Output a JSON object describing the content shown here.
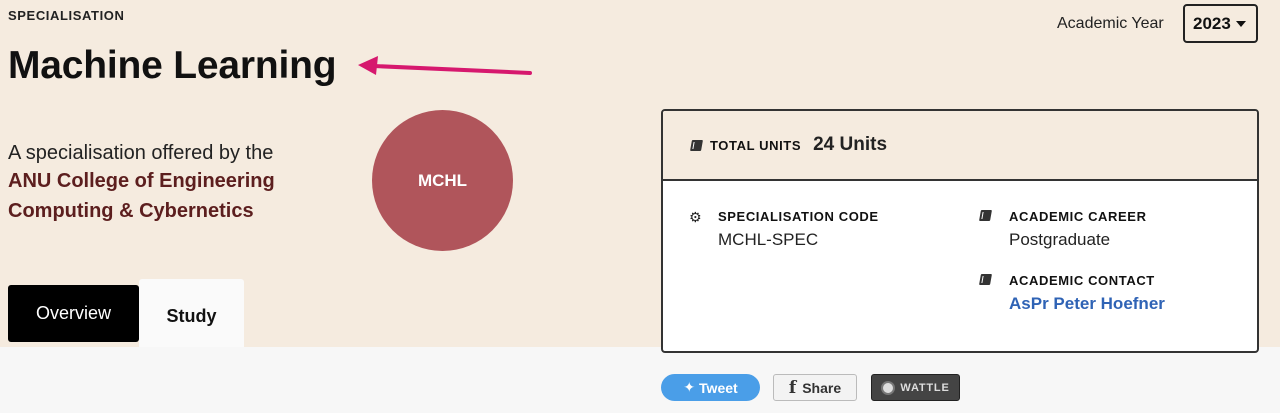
{
  "header": {
    "overline": "SPECIALISATION",
    "title": "Machine Learning",
    "academic_year_label": "Academic Year",
    "academic_year_value": "2023"
  },
  "intro": {
    "offered_by": "A specialisation offered by the",
    "college": "ANU College of Engineering Computing & Cybernetics",
    "badge": "MCHL"
  },
  "tabs": [
    {
      "label": "Overview",
      "active": true
    },
    {
      "label": "Study",
      "active": false
    }
  ],
  "card": {
    "total_units_label": "TOTAL UNITS",
    "total_units_value": "24 Units",
    "spec_code_label": "SPECIALISATION CODE",
    "spec_code_value": "MCHL-SPEC",
    "career_label": "ACADEMIC CAREER",
    "career_value": "Postgraduate",
    "contact_label": "ACADEMIC CONTACT",
    "contact_value": "AsPr Peter Hoefner"
  },
  "social": {
    "tweet": "Tweet",
    "share": "Share",
    "wattle": "WATTLE"
  },
  "colors": {
    "accent_maroon": "#5c1e1e",
    "badge": "#b0555b",
    "arrow": "#d6186e",
    "link": "#2f63b5"
  }
}
